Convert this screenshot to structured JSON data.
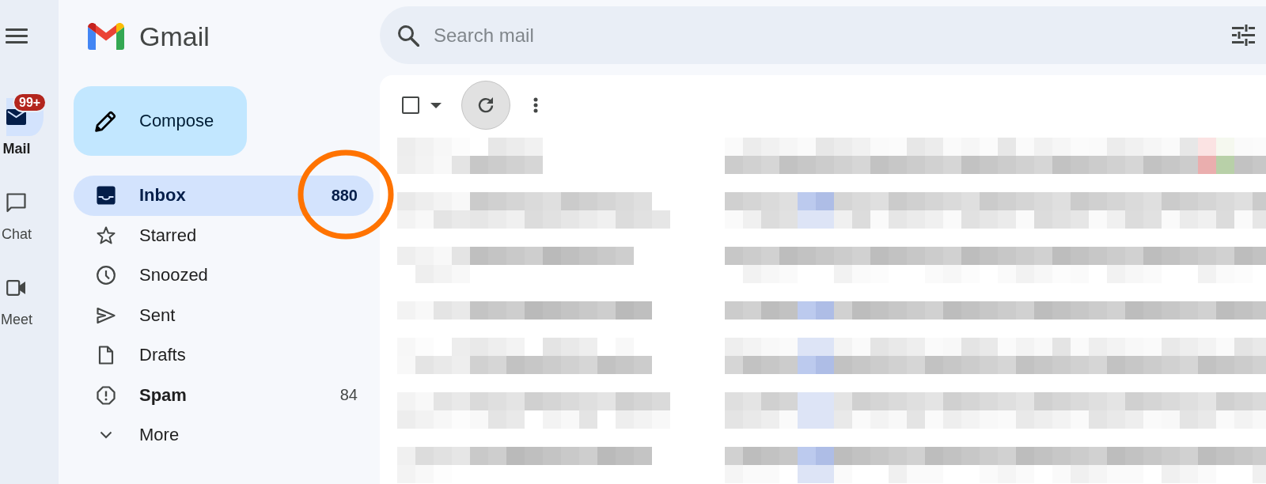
{
  "rail": {
    "items": [
      {
        "label": "Mail",
        "selected": true,
        "badge": "99+"
      },
      {
        "label": "Chat",
        "selected": false
      },
      {
        "label": "Meet",
        "selected": false
      }
    ]
  },
  "logo": {
    "text": "Gmail"
  },
  "compose_button": {
    "label": "Compose"
  },
  "folders": [
    {
      "label": "Inbox",
      "selected": true,
      "unread": true,
      "count": "880",
      "circled": true
    },
    {
      "label": "Starred",
      "selected": false,
      "unread": false,
      "circled": false
    },
    {
      "label": "Snoozed",
      "selected": false,
      "unread": false,
      "circled": false
    },
    {
      "label": "Sent",
      "selected": false,
      "unread": false,
      "circled": false
    },
    {
      "label": "Drafts",
      "selected": false,
      "unread": false,
      "circled": false
    },
    {
      "label": "Spam",
      "selected": false,
      "unread": true,
      "count": "84",
      "circled": false
    },
    {
      "label": "More",
      "selected": false,
      "unread": false,
      "circled": false
    }
  ],
  "search": {
    "placeholder": "Search mail"
  },
  "toolbar": {
    "checkbox": {
      "checked": false
    },
    "refresh": {
      "hovered": true
    }
  },
  "message_list": {
    "kind": "pixelated"
  }
}
